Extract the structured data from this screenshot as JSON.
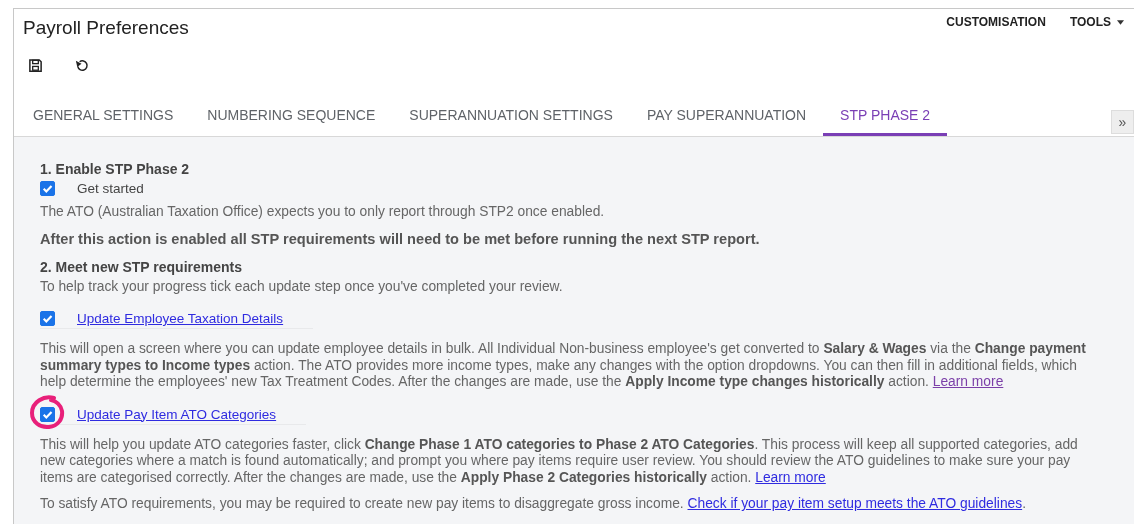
{
  "window": {
    "title": "Payroll Preferences"
  },
  "header_menu": [
    {
      "label": "CUSTOMISATION",
      "dropdown": false
    },
    {
      "label": "TOOLS",
      "dropdown": true
    }
  ],
  "toolbar": [
    {
      "kind": "save"
    },
    {
      "kind": "undo"
    }
  ],
  "tabs": [
    {
      "label": "GENERAL SETTINGS",
      "selected": false
    },
    {
      "label": "NUMBERING SEQUENCE",
      "selected": false
    },
    {
      "label": "SUPERANNUATION SETTINGS",
      "selected": false
    },
    {
      "label": "PAY SUPERANNUATION",
      "selected": false
    },
    {
      "label": "STP PHASE 2",
      "selected": true
    }
  ],
  "tab_scroll": "»",
  "blocks": [
    {
      "kind": "heading",
      "text": "1. Enable STP Phase 2"
    },
    {
      "kind": "check",
      "label": "Get started",
      "checked": true,
      "link": false,
      "highlighted": false
    },
    {
      "kind": "para",
      "text": "The ATO (Australian Taxation Office) expects you to only report through STP2 once enabled."
    },
    {
      "kind": "warning",
      "text": "After this action is enabled all STP requirements will need to be met before running the next STP report."
    },
    {
      "kind": "heading",
      "text": "2. Meet new STP requirements"
    },
    {
      "kind": "para",
      "text": "To help track your progress tick each update step once you've completed your review."
    },
    {
      "kind": "check",
      "label": "Update Employee Taxation Details",
      "checked": true,
      "link": true,
      "highlighted": false
    },
    {
      "kind": "para",
      "text": "This will open a screen where you can update employee details in bulk. All Individual Non-business employee's get converted to **Salary & Wages** via the **Change payment summary types to Income types** action. The ATO provides more income types, make any changes with the option dropdowns. You can then fill in additional fields, which help determine the employees' new Tax Treatment Codes. After the changes are made, use the **Apply Income type changes historically** action.",
      "link": "Learn more",
      "visited": true
    },
    {
      "kind": "check",
      "label": "Update Pay Item ATO Categories",
      "checked": true,
      "link": true,
      "highlighted": true
    },
    {
      "kind": "para",
      "text": "This will help you update ATO categories faster, click **Change Phase 1 ATO categories to Phase 2 ATO Categories**. This process will keep all supported categories, add new categories where a match is found automatically; and prompt you where pay items require user review. You should review the ATO guidelines to make sure your pay items are categorised correctly. After the changes are made, use the **Apply Phase 2 Categories historically** action.",
      "link": "Learn more",
      "visited": false
    },
    {
      "kind": "para",
      "text": "To satisfy ATO requirements, you may be required to create new pay items to disaggregate gross income.",
      "link": "Check if your pay item setup meets the ATO guidelines",
      "visited": false,
      "tail": "."
    }
  ]
}
